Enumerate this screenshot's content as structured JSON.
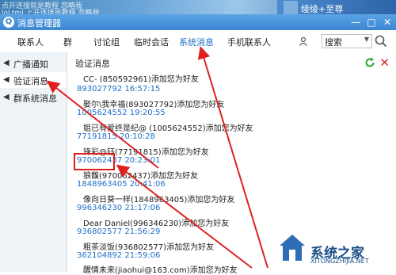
{
  "desktop": {
    "bg_text_1": "点开连接就是教程 忽略我",
    "bg_text_2": "loLtml 上开连接是教程 忽略我",
    "user_name": "绫绫+至尊"
  },
  "window": {
    "title": "消息管理器",
    "min_label": "—",
    "max_label": "□",
    "close_label": "✕"
  },
  "tabs": [
    {
      "label": "联系人"
    },
    {
      "label": "群"
    },
    {
      "label": "讨论组"
    },
    {
      "label": "临时会话"
    },
    {
      "label": "系统消息"
    },
    {
      "label": "手机联系人"
    }
  ],
  "search": {
    "label": "搜索"
  },
  "sidebar": {
    "items": [
      {
        "label": "广播通知"
      },
      {
        "label": "验证消息"
      },
      {
        "label": "群系统消息"
      }
    ]
  },
  "main": {
    "section_title": "验证消息",
    "entries": [
      {
        "num": "",
        "msg": "CC-                    (850592961)添加您为好友"
      },
      {
        "num": "893027792 16:57:15",
        "msg": "娶尔\\我幸福(893027792)添加您为好友"
      },
      {
        "num": "1005624552 19:20:55",
        "msg": "姐已有爱终是纪@ (1005624552)添加您为好友"
      },
      {
        "num": "77191815 20:10:28",
        "msg": "锋彩@钰(77191815)添加您为好友"
      },
      {
        "num": "970062437 20:23:01",
        "msg": "狼馥(970062437)添加您为好友"
      },
      {
        "num": "1848963405 20:41:06",
        "msg": "像向日葵一样(1848963405)添加您为好友"
      },
      {
        "num": "996346230 21:17:06",
        "msg": "Dear Daniel(996346230)添加您为好友"
      },
      {
        "num": "936802577 21:56:29",
        "msg": "粗茶淡饭(936802577)添加您为好友"
      },
      {
        "num": "362104892 21:59:06",
        "msg": "醒情未来(jiaohui@163.com)添加您为好友"
      }
    ]
  },
  "watermark": {
    "text": "系统之家",
    "sub": "XITONGZHIJIA.NET"
  },
  "colors": {
    "accent": "#1e6fc8",
    "arrow": "#e02020"
  }
}
